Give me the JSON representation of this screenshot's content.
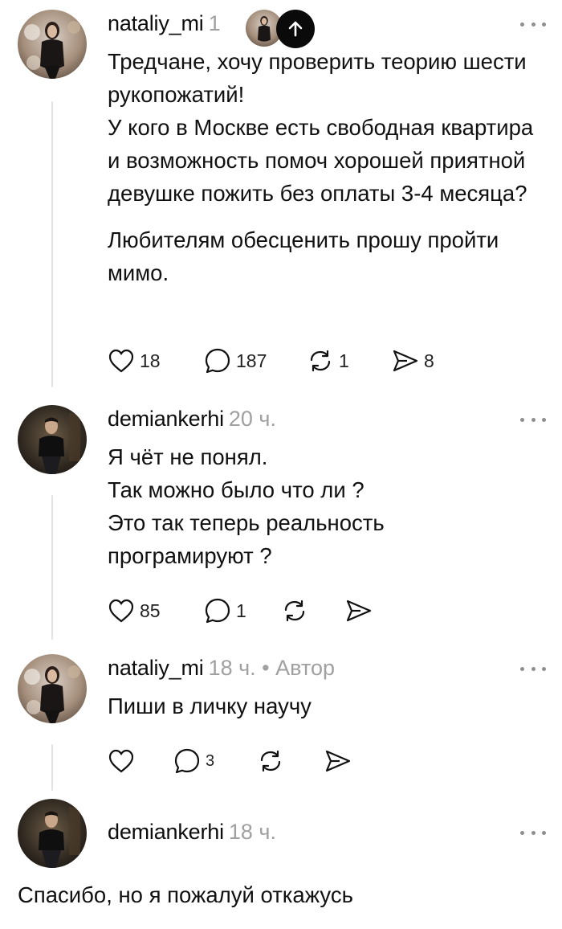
{
  "posts": [
    {
      "username": "nataliy_mi",
      "meta": "1",
      "paragraphs": [
        "Тредчане, хочу проверить теорию шести рукопожатий!",
        "У кого в Москве есть свободная квартира и возможность помоч хорошей приятной девушке пожить без оплаты 3-4 месяца?",
        "Любителям обесценить прошу пройти мимо."
      ],
      "likes": "18",
      "comments": "187",
      "reposts": "1",
      "shares": "8"
    },
    {
      "username": "demiankerhi",
      "meta": "20 ч.",
      "lines": [
        "Я чёт не понял.",
        "Так можно было что ли ?",
        "Это так теперь реальность",
        "програмируют ?"
      ],
      "likes": "85",
      "comments": "1"
    },
    {
      "username": "nataliy_mi",
      "meta": "18 ч. • Автор",
      "lines": [
        "Пиши в личку научу"
      ],
      "comments": "3"
    },
    {
      "username": "demiankerhi",
      "meta": "18 ч.",
      "text": "Спасибо, но я пожалуй откажусь"
    }
  ],
  "icons": {
    "like": "heart-icon",
    "comment": "comment-icon",
    "repost": "repost-icon",
    "share": "share-icon",
    "scroll_top": "arrow-up-icon",
    "more": "more-icon"
  },
  "colors": {
    "text": "#111111",
    "meta": "#a0a0a0",
    "thread_line": "#e2e2e2",
    "button_bg": "#0a0a0a"
  }
}
